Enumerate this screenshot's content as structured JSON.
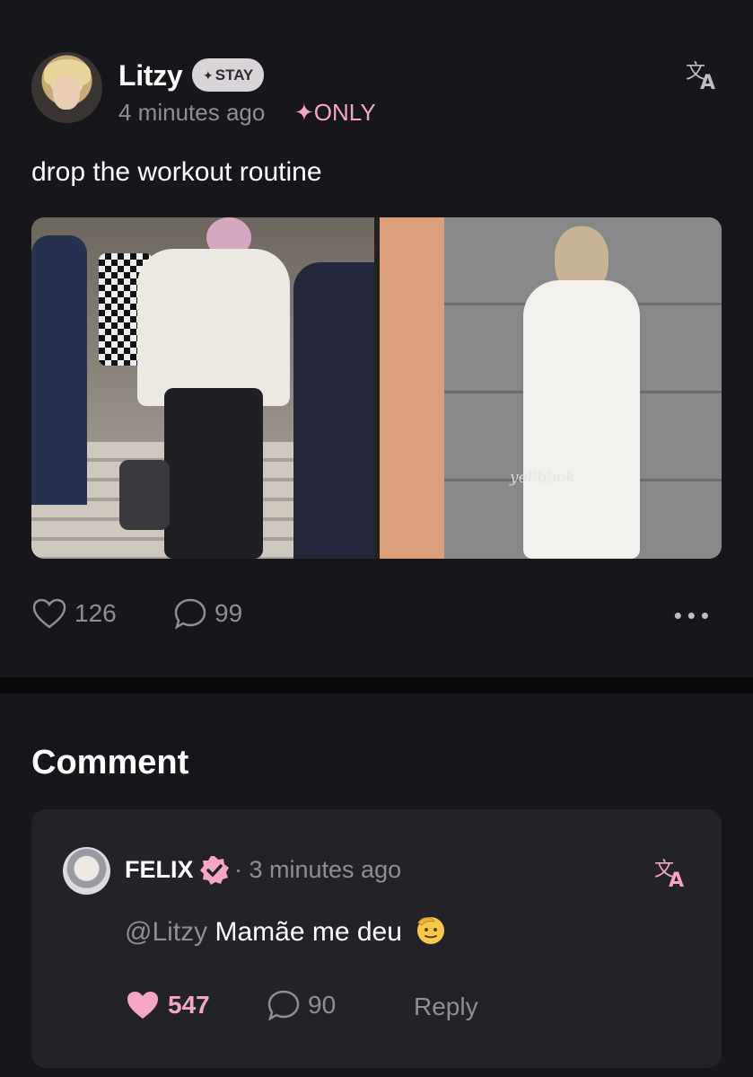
{
  "post": {
    "author": "Litzy",
    "badge": "STAY",
    "badge_icon": "sparkle-icon",
    "time": "4 minutes ago",
    "visibility": "✦ONLY",
    "text": "drop the workout routine",
    "watermark": "yellbbok",
    "likes": "126",
    "comments": "99",
    "more_icon": "more-dots-icon"
  },
  "comments_section": {
    "heading": "Comment",
    "items": [
      {
        "author": "FELIX",
        "verified": true,
        "time": "· 3 minutes ago",
        "mention": "@Litzy",
        "text": "Mamãe me deu",
        "emoji": "🫡",
        "likes": "547",
        "replies": "90",
        "reply_label": "Reply"
      }
    ]
  },
  "colors": {
    "background": "#16161b",
    "card": "#222228",
    "accent_pink": "#f4a6c4",
    "muted": "#8e8e96"
  }
}
